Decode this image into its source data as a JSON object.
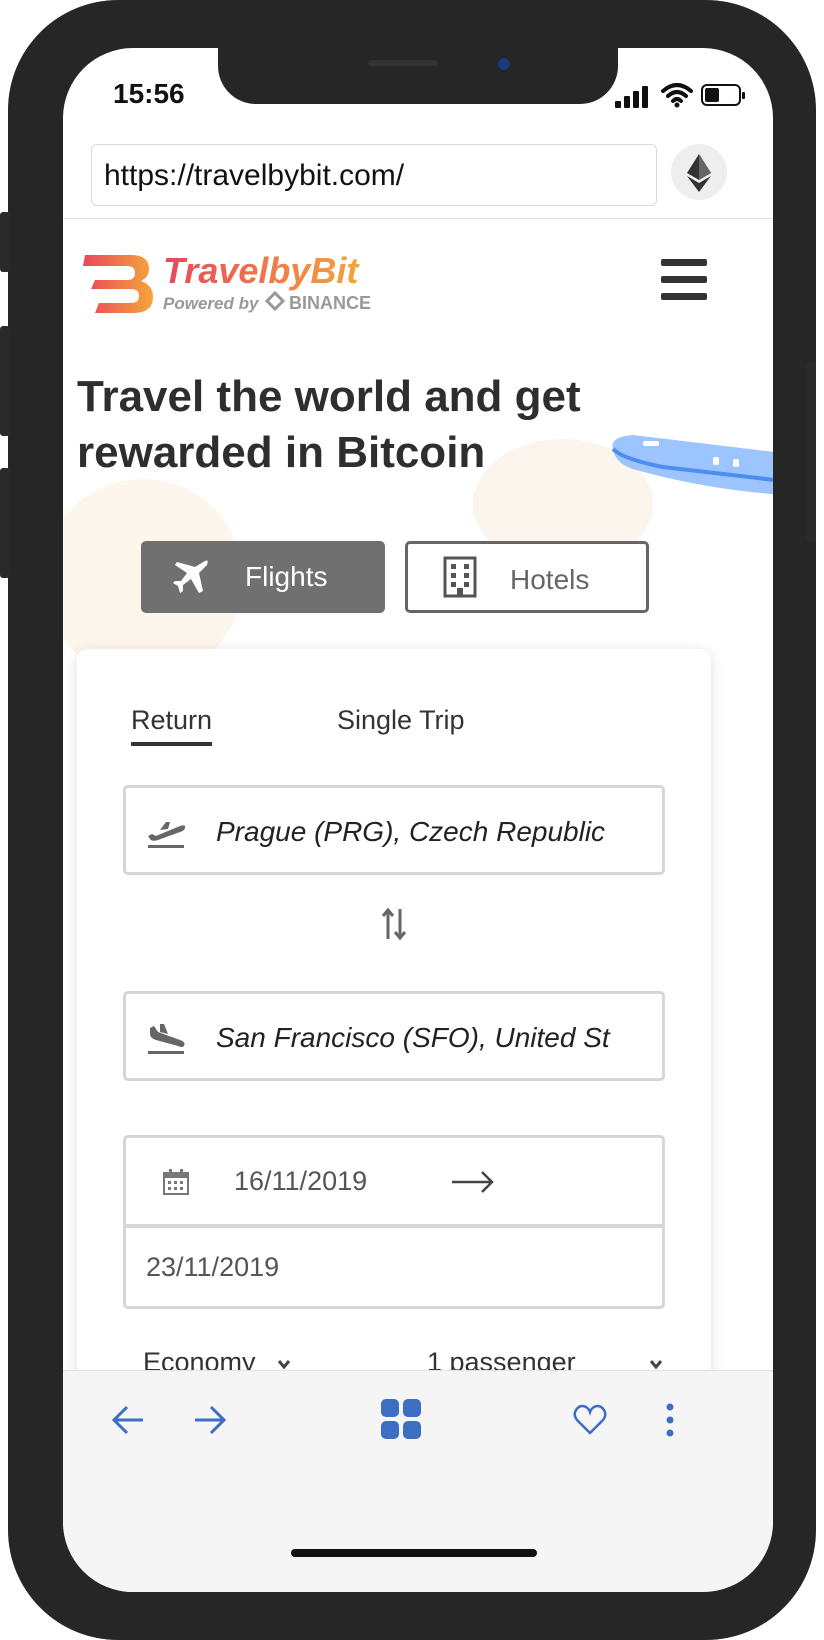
{
  "status_bar": {
    "time": "15:56"
  },
  "browser": {
    "url": "https://travelbybit.com/",
    "wallet_icon": "ethereum-icon"
  },
  "site": {
    "logo_name": "TravelbyBit",
    "logo_tagline": "Powered by",
    "logo_partner": "BINANCE",
    "headline_line1": "Travel the world and get",
    "headline_line2": "rewarded in Bitcoin"
  },
  "tabs": [
    {
      "label": "Flights",
      "icon": "airplane-icon",
      "active": true
    },
    {
      "label": "Hotels",
      "icon": "building-icon",
      "active": false
    }
  ],
  "search": {
    "trip_types": [
      {
        "label": "Return",
        "active": true
      },
      {
        "label": "Single Trip",
        "active": false
      }
    ],
    "origin": "Prague (PRG), Czech Republic",
    "destination": "San Francisco (SFO), United St",
    "depart_date": "16/11/2019",
    "return_date": "23/11/2019",
    "cabin_class": "Economy",
    "passengers": "1 passenger"
  },
  "colors": {
    "brand_gradient_start": "#e8475f",
    "brand_gradient_end": "#f5a53a",
    "toolbar_icon": "#3c6fc1"
  }
}
